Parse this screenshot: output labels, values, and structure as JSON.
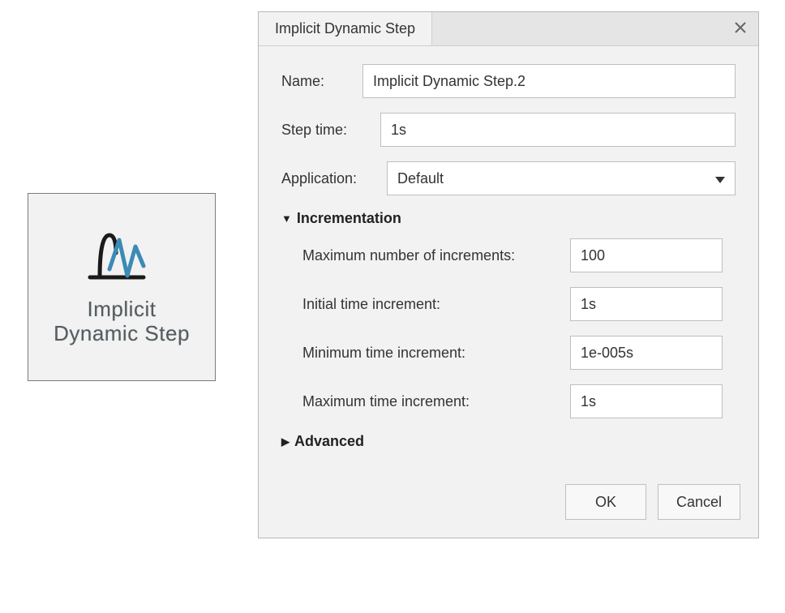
{
  "tile": {
    "label": "Implicit\nDynamic Step"
  },
  "dialog": {
    "title": "Implicit Dynamic Step",
    "fields": {
      "name_label": "Name:",
      "name_value": "Implicit Dynamic Step.2",
      "steptime_label": "Step time:",
      "steptime_value": "1s",
      "application_label": "Application:",
      "application_value": "Default"
    },
    "sections": {
      "incrementation": {
        "header": "Incrementation",
        "max_increments_label": "Maximum number of increments:",
        "max_increments_value": "100",
        "initial_ti_label": "Initial time increment:",
        "initial_ti_value": "1s",
        "min_ti_label": "Minimum time increment:",
        "min_ti_value": "1e-005s",
        "max_ti_label": "Maximum time increment:",
        "max_ti_value": "1s"
      },
      "advanced": {
        "header": "Advanced"
      }
    },
    "buttons": {
      "ok": "OK",
      "cancel": "Cancel"
    }
  }
}
